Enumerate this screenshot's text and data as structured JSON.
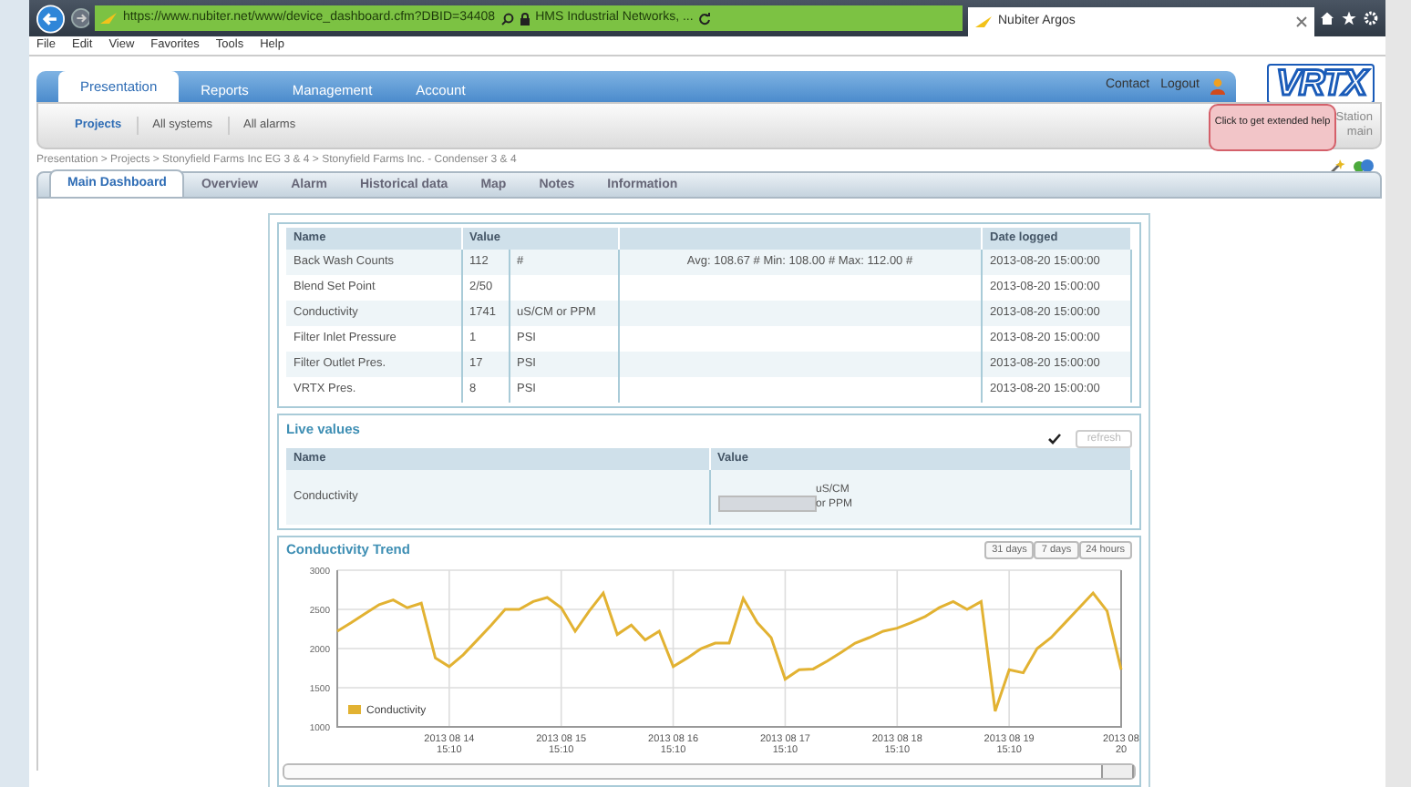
{
  "browser": {
    "url": "https://www.nubiter.net/www/device_dashboard.cfm?DBID=34408",
    "site_identity": "HMS Industrial Networks, ...",
    "tab_title": "Nubiter Argos",
    "menu": [
      "File",
      "Edit",
      "View",
      "Favorites",
      "Tools",
      "Help"
    ]
  },
  "nav": {
    "tabs": [
      {
        "label": "Presentation",
        "selected": true
      },
      {
        "label": "Reports",
        "selected": false
      },
      {
        "label": "Management",
        "selected": false
      },
      {
        "label": "Account",
        "selected": false
      }
    ],
    "links": [
      "Contact",
      "Logout"
    ],
    "logo": "VRTX"
  },
  "subnav": {
    "items": [
      {
        "label": "Projects",
        "selected": true
      },
      {
        "label": "All systems",
        "selected": false
      },
      {
        "label": "All alarms",
        "selected": false
      }
    ],
    "station_lines": [
      "Station",
      "main"
    ]
  },
  "tooltip": "Click to get extended help",
  "breadcrumb": "Presentation > Projects > Stonyfield Farms Inc EG 3 & 4 > Stonyfield Farms Inc. - Condenser 3 & 4",
  "page_tabs": [
    {
      "label": "Main Dashboard",
      "selected": true
    },
    {
      "label": "Overview",
      "selected": false
    },
    {
      "label": "Alarm",
      "selected": false
    },
    {
      "label": "Historical data",
      "selected": false
    },
    {
      "label": "Map",
      "selected": false
    },
    {
      "label": "Notes",
      "selected": false
    },
    {
      "label": "Information",
      "selected": false
    }
  ],
  "table": {
    "columns": [
      "Name",
      "Value",
      "Date logged"
    ],
    "rows": [
      {
        "name": "Back Wash Counts",
        "value": "112",
        "unit": "#",
        "stats": "Avg: 108.67 # Min: 108.00 # Max: 112.00 #",
        "date": "2013-08-20 15:00:00"
      },
      {
        "name": "Blend Set Point",
        "value": "2/50",
        "unit": "",
        "stats": "",
        "date": "2013-08-20 15:00:00"
      },
      {
        "name": "Conductivity",
        "value": "1741",
        "unit": "uS/CM or PPM",
        "stats": "",
        "date": "2013-08-20 15:00:00"
      },
      {
        "name": "Filter Inlet Pressure",
        "value": "1",
        "unit": "PSI",
        "stats": "",
        "date": "2013-08-20 15:00:00"
      },
      {
        "name": "Filter Outlet Pres.",
        "value": "17",
        "unit": "PSI",
        "stats": "",
        "date": "2013-08-20 15:00:00"
      },
      {
        "name": "VRTX Pres.",
        "value": "8",
        "unit": "PSI",
        "stats": "",
        "date": "2013-08-20 15:00:00"
      }
    ]
  },
  "live_values": {
    "title": "Live values",
    "refresh": {
      "label": "refresh",
      "disabled": true
    },
    "columns": [
      "Name",
      "Value"
    ],
    "rows": [
      {
        "name": "Conductivity",
        "unit": "uS/CM or PPM"
      }
    ]
  },
  "trend": {
    "title": "Conductivity Trend",
    "ranges": [
      "31 days",
      "7 days",
      "24 hours"
    ],
    "chart_data": {
      "type": "line",
      "grid": true,
      "ylim": [
        1000,
        3000
      ],
      "yticks": [
        1000,
        1500,
        2000,
        2500,
        3000
      ],
      "categories": [
        null,
        null,
        null,
        null,
        null,
        null,
        null,
        null,
        "2013 08 14 15:10",
        null,
        null,
        null,
        null,
        null,
        null,
        null,
        "2013 08 15 15:10",
        null,
        null,
        null,
        null,
        null,
        null,
        null,
        "2013 08 16 15:10",
        null,
        null,
        null,
        null,
        null,
        null,
        null,
        "2013 08 17 15:10",
        null,
        null,
        null,
        null,
        null,
        null,
        null,
        "2013 08 18 15:10",
        null,
        null,
        null,
        null,
        null,
        null,
        null,
        "2013 08 19 15:10",
        null,
        null,
        null,
        null,
        null,
        null,
        null,
        "2013 08 20"
      ],
      "series": [
        {
          "name": "Conductivity",
          "color": "#e2b232",
          "values": [
            2220,
            2330,
            2450,
            2560,
            2620,
            2520,
            2580,
            1880,
            1770,
            1920,
            2110,
            2300,
            2500,
            2500,
            2600,
            2650,
            2520,
            2220,
            2480,
            2710,
            2180,
            2300,
            2110,
            2220,
            1770,
            1880,
            2000,
            2070,
            2070,
            2640,
            2330,
            2140,
            1610,
            1730,
            1740,
            1840,
            1950,
            2070,
            2140,
            2220,
            2260,
            2330,
            2410,
            2520,
            2600,
            2500,
            2600,
            1200,
            1730,
            1690,
            2000,
            2140,
            2330,
            2520,
            2710,
            2480,
            1730
          ]
        }
      ]
    }
  }
}
